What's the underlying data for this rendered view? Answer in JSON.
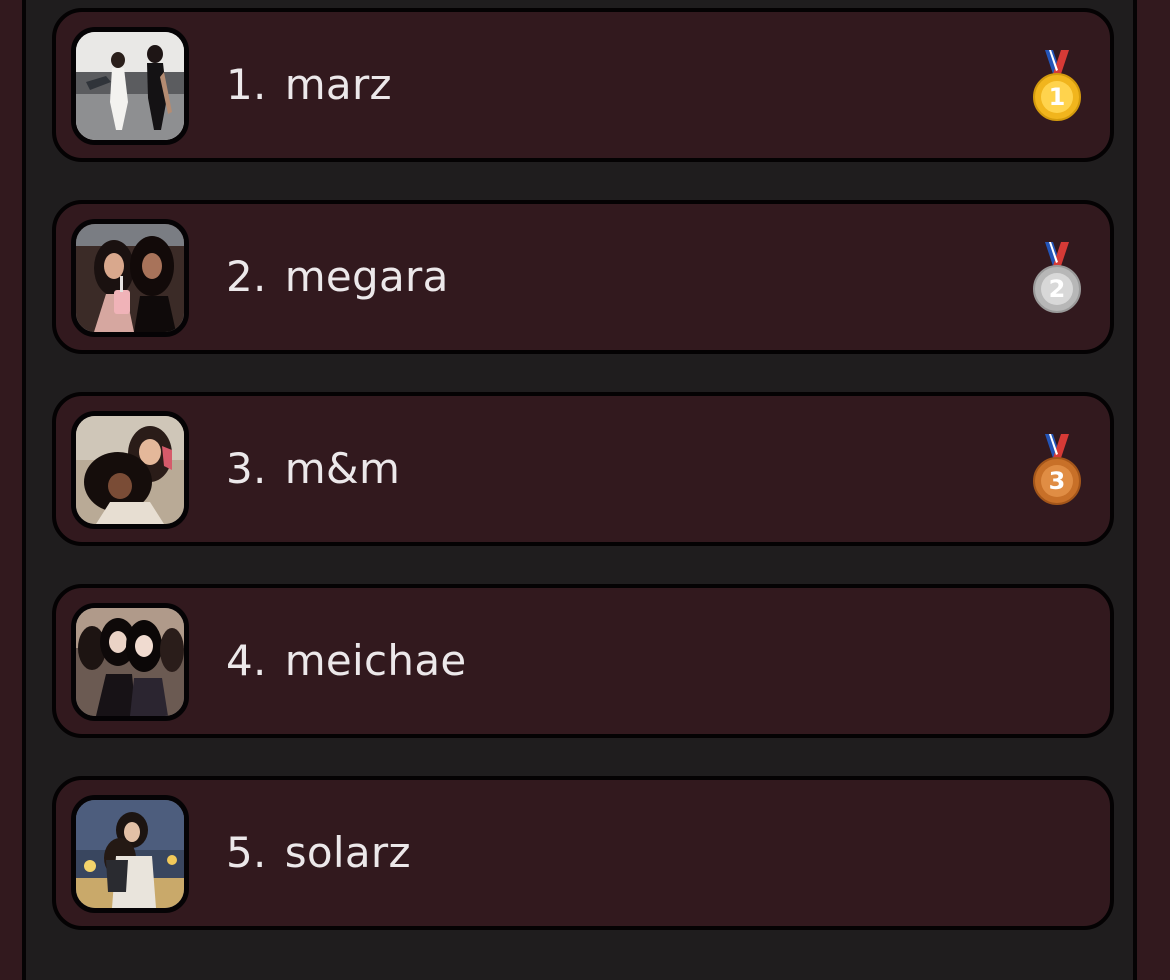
{
  "ranking": [
    {
      "rank": "1.",
      "name": "marz",
      "medal": "gold-medal-icon",
      "medal_digit": "1",
      "medal_color": "#f1b51d",
      "avatar": "group-photo"
    },
    {
      "rank": "2.",
      "name": "megara",
      "medal": "silver-medal-icon",
      "medal_digit": "2",
      "medal_color": "#b7b7b7",
      "avatar": "duo-photo"
    },
    {
      "rank": "3.",
      "name": "m&m",
      "medal": "bronze-medal-icon",
      "medal_digit": "3",
      "medal_color": "#c87028",
      "avatar": "duo-selfie-photo"
    },
    {
      "rank": "4.",
      "name": "meichae",
      "medal": "",
      "medal_digit": "",
      "avatar": "party-photo"
    },
    {
      "rank": "5.",
      "name": "solarz",
      "medal": "",
      "medal_digit": "",
      "avatar": "outdoor-photo"
    }
  ],
  "colors": {
    "page_background": "#32191e",
    "panel_background": "#1f1d1e",
    "card_background": "#32191e",
    "card_border": "#040203",
    "text": "#ece8ea"
  }
}
